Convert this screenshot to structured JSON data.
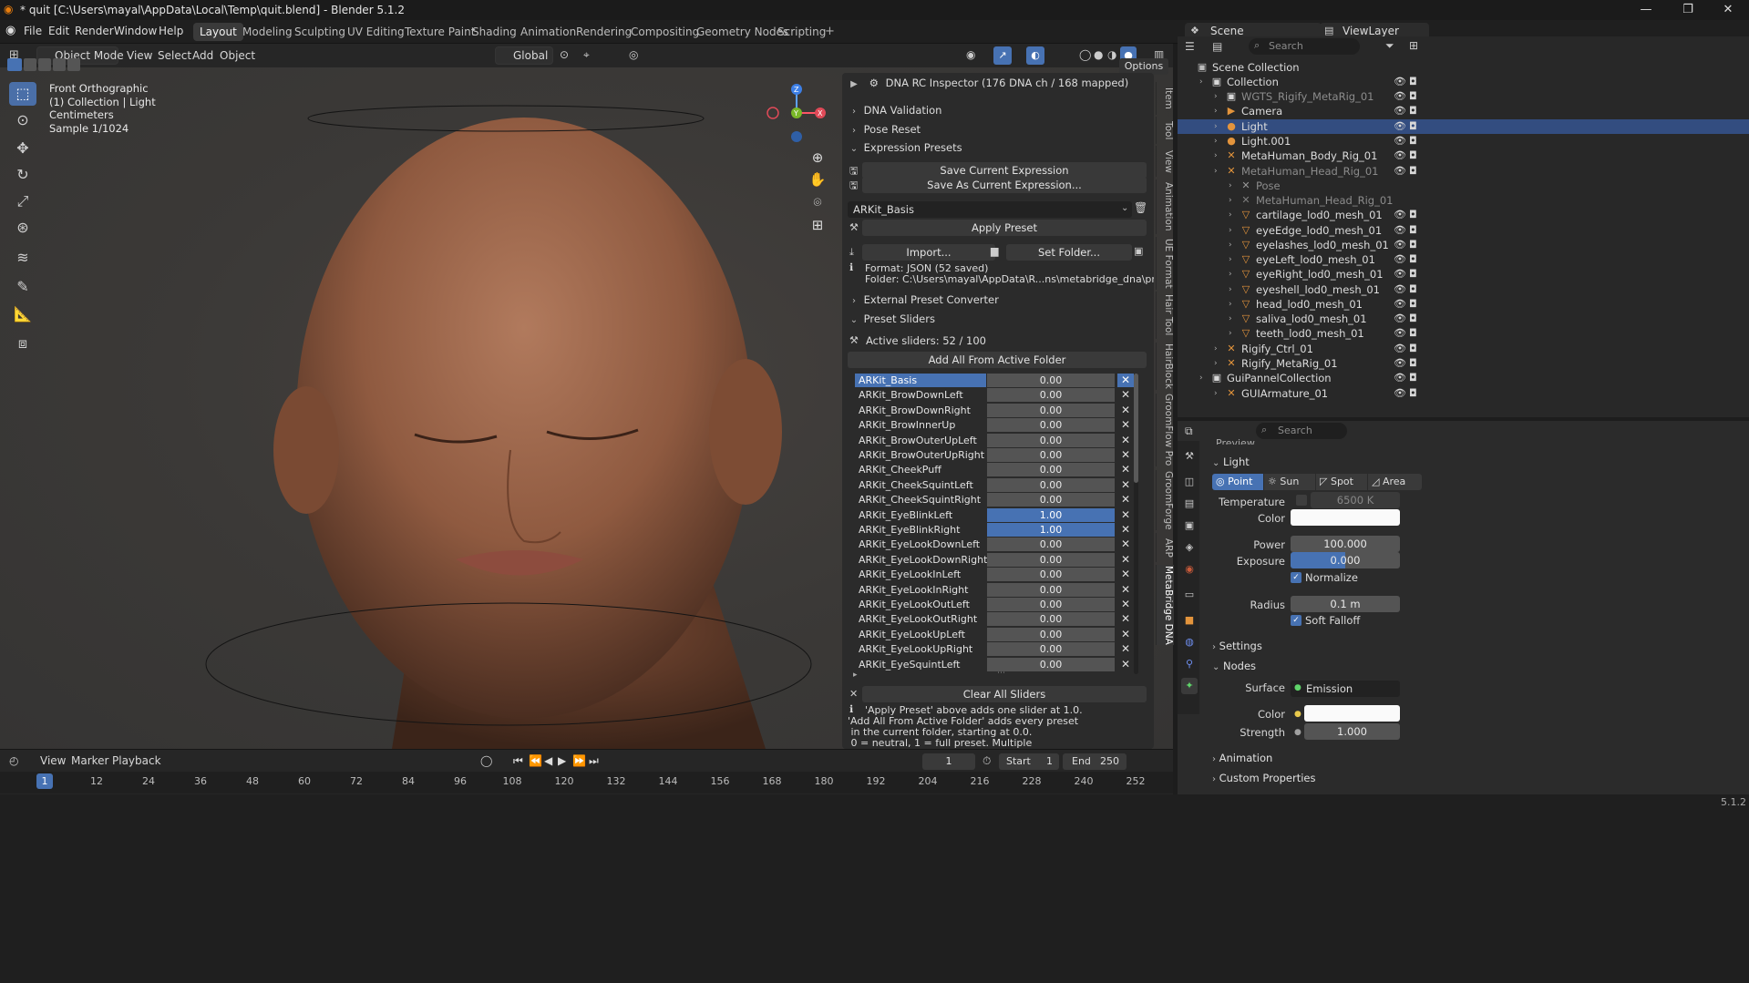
{
  "window": {
    "title": "* quit [C:\\Users\\mayal\\AppData\\Local\\Temp\\quit.blend] - Blender 5.1.2"
  },
  "menubar": {
    "items": [
      "File",
      "Edit",
      "Render",
      "Window",
      "Help"
    ],
    "workspaces": [
      "Layout",
      "Modeling",
      "Sculpting",
      "UV Editing",
      "Texture Paint",
      "Shading",
      "Animation",
      "Rendering",
      "Compositing",
      "Geometry Nodes",
      "Scripting"
    ],
    "scene_label": "Scene",
    "viewlayer_label": "ViewLayer"
  },
  "viewport_header": {
    "mode": "Object Mode",
    "menus": [
      "View",
      "Select",
      "Add",
      "Object"
    ],
    "orientation": "Global",
    "options": "Options"
  },
  "viewport_info": {
    "line1": "Front Orthographic",
    "line2": "(1) Collection | Light",
    "line3": "Centimeters",
    "line4": "Sample 1/1024"
  },
  "side_tabs": [
    "Item",
    "Tool",
    "View",
    "Animation",
    "UE Format",
    "Hair Tool",
    "HairBlock",
    "GroomFlow Pro",
    "GroomForge",
    "ARP",
    "MetaBridge DNA"
  ],
  "npanel": {
    "inspector": "DNA RC Inspector  (176 DNA ch / 168 mapped)",
    "dna_validation": "DNA Validation",
    "pose_reset": "Pose Reset",
    "expression_presets": "Expression Presets",
    "save_current": "Save Current Expression",
    "save_as_current": "Save As Current Expression...",
    "preset_selected": "ARKit_Basis",
    "apply_preset": "Apply Preset",
    "import": "Import...",
    "set_folder": "Set Folder...",
    "format": "Format: JSON  (52 saved)",
    "folder": "Folder: C:\\Users\\mayal\\AppData\\R...ns\\metabridge_dna\\presets\\ARKit",
    "external_converter": "External Preset Converter",
    "preset_sliders": "Preset Sliders",
    "active_sliders": "Active sliders: 52 / 100",
    "add_all": "Add All From Active Folder",
    "clear_all": "Clear All Sliders",
    "help_1": "'Apply Preset' above adds one slider at 1.0.",
    "help_2": "'Add All From Active Folder' adds every preset",
    "help_3": " in the current folder, starting at 0.0.",
    "help_4": " 0 = neutral, 1 = full preset. Multiple"
  },
  "sliders": [
    {
      "name": "ARKit_Basis",
      "value": "0.00",
      "selected": true,
      "on": false
    },
    {
      "name": "ARKit_BrowDownLeft",
      "value": "0.00",
      "selected": false,
      "on": false
    },
    {
      "name": "ARKit_BrowDownRight",
      "value": "0.00",
      "selected": false,
      "on": false
    },
    {
      "name": "ARKit_BrowInnerUp",
      "value": "0.00",
      "selected": false,
      "on": false
    },
    {
      "name": "ARKit_BrowOuterUpLeft",
      "value": "0.00",
      "selected": false,
      "on": false
    },
    {
      "name": "ARKit_BrowOuterUpRight",
      "value": "0.00",
      "selected": false,
      "on": false
    },
    {
      "name": "ARKit_CheekPuff",
      "value": "0.00",
      "selected": false,
      "on": false
    },
    {
      "name": "ARKit_CheekSquintLeft",
      "value": "0.00",
      "selected": false,
      "on": false
    },
    {
      "name": "ARKit_CheekSquintRight",
      "value": "0.00",
      "selected": false,
      "on": false
    },
    {
      "name": "ARKit_EyeBlinkLeft",
      "value": "1.00",
      "selected": false,
      "on": true
    },
    {
      "name": "ARKit_EyeBlinkRight",
      "value": "1.00",
      "selected": false,
      "on": true
    },
    {
      "name": "ARKit_EyeLookDownLeft",
      "value": "0.00",
      "selected": false,
      "on": false
    },
    {
      "name": "ARKit_EyeLookDownRight",
      "value": "0.00",
      "selected": false,
      "on": false
    },
    {
      "name": "ARKit_EyeLookInLeft",
      "value": "0.00",
      "selected": false,
      "on": false
    },
    {
      "name": "ARKit_EyeLookInRight",
      "value": "0.00",
      "selected": false,
      "on": false
    },
    {
      "name": "ARKit_EyeLookOutLeft",
      "value": "0.00",
      "selected": false,
      "on": false
    },
    {
      "name": "ARKit_EyeLookOutRight",
      "value": "0.00",
      "selected": false,
      "on": false
    },
    {
      "name": "ARKit_EyeLookUpLeft",
      "value": "0.00",
      "selected": false,
      "on": false
    },
    {
      "name": "ARKit_EyeLookUpRight",
      "value": "0.00",
      "selected": false,
      "on": false
    },
    {
      "name": "ARKit_EyeSquintLeft",
      "value": "0.00",
      "selected": false,
      "on": false
    }
  ],
  "timeline": {
    "menus": [
      "View",
      "Marker",
      "Playback"
    ],
    "current_frame": "1",
    "start_label": "Start",
    "start": "1",
    "end_label": "End",
    "end": "250",
    "ticks": [
      "1",
      "12",
      "24",
      "36",
      "48",
      "60",
      "72",
      "84",
      "96",
      "108",
      "120",
      "132",
      "144",
      "156",
      "168",
      "180",
      "192",
      "204",
      "216",
      "228",
      "240",
      "252"
    ]
  },
  "outliner": {
    "search_placeholder": "Search",
    "rows": [
      {
        "name": "Scene Collection",
        "icon": "scene-collection-icon",
        "sel": false
      },
      {
        "name": "Collection",
        "icon": "collection-icon",
        "sel": false
      },
      {
        "name": "WGTS_Rigify_MetaRig_01",
        "icon": "collection-icon",
        "sel": false
      },
      {
        "name": "Camera",
        "icon": "camera-icon",
        "sel": false
      },
      {
        "name": "Light",
        "icon": "light-icon",
        "sel": true
      },
      {
        "name": "Light.001",
        "icon": "light-icon",
        "sel": false
      },
      {
        "name": "MetaHuman_Body_Rig_01",
        "icon": "armature-icon",
        "sel": false
      },
      {
        "name": "MetaHuman_Head_Rig_01",
        "icon": "armature-icon",
        "sel": false
      },
      {
        "name": "Pose",
        "icon": "pose-icon",
        "sel": false
      },
      {
        "name": "MetaHuman_Head_Rig_01",
        "icon": "armature-data-icon",
        "sel": false
      },
      {
        "name": "cartilage_lod0_mesh_01",
        "icon": "mesh-icon",
        "sel": false
      },
      {
        "name": "eyeEdge_lod0_mesh_01",
        "icon": "mesh-icon",
        "sel": false
      },
      {
        "name": "eyelashes_lod0_mesh_01",
        "icon": "mesh-icon",
        "sel": false
      },
      {
        "name": "eyeLeft_lod0_mesh_01",
        "icon": "mesh-icon",
        "sel": false
      },
      {
        "name": "eyeRight_lod0_mesh_01",
        "icon": "mesh-icon",
        "sel": false
      },
      {
        "name": "eyeshell_lod0_mesh_01",
        "icon": "mesh-icon",
        "sel": false
      },
      {
        "name": "head_lod0_mesh_01",
        "icon": "mesh-icon",
        "sel": false
      },
      {
        "name": "saliva_lod0_mesh_01",
        "icon": "mesh-icon",
        "sel": false
      },
      {
        "name": "teeth_lod0_mesh_01",
        "icon": "mesh-icon",
        "sel": false
      },
      {
        "name": "Rigify_Ctrl_01",
        "icon": "armature-icon",
        "sel": false
      },
      {
        "name": "Rigify_MetaRig_01",
        "icon": "armature-icon",
        "sel": false
      },
      {
        "name": "GuiPannelCollection",
        "icon": "collection-icon",
        "sel": false
      },
      {
        "name": "GUIArmature_01",
        "icon": "armature-icon",
        "sel": false
      }
    ]
  },
  "properties": {
    "search_placeholder": "Search",
    "preview": "Preview",
    "light_header": "Light",
    "types": [
      "Point",
      "Sun",
      "Spot",
      "Area"
    ],
    "temperature_label": "Temperature",
    "temperature": "6500 K",
    "color_label": "Color",
    "power_label": "Power",
    "power": "100.000",
    "exposure_label": "Exposure",
    "exposure": "0.000",
    "normalize": "Normalize",
    "radius_label": "Radius",
    "radius": "0.1 m",
    "soft_falloff": "Soft Falloff",
    "settings": "Settings",
    "nodes": "Nodes",
    "surface_label": "Surface",
    "surface": "Emission",
    "strength_label": "Strength",
    "strength": "1.000",
    "animation": "Animation",
    "custom_properties": "Custom Properties"
  },
  "version": "5.1.2",
  "colors": {
    "accent": "#4772b3",
    "selection": "#334d80",
    "background": "#1d1d1d"
  }
}
